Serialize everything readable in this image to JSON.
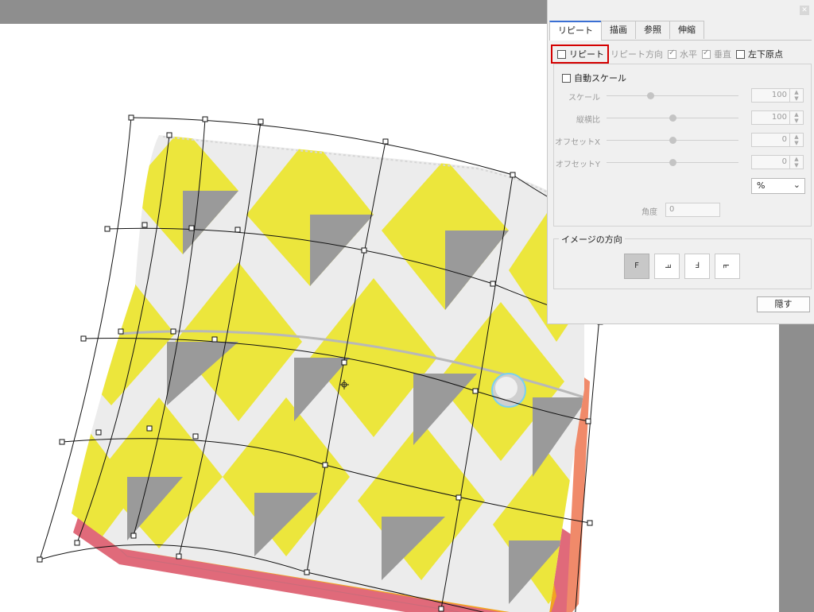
{
  "panel": {
    "tabs": [
      "リピート",
      "描画",
      "参照",
      "伸縮"
    ],
    "repeat_label": "リピート",
    "repeat_direction_label": "リピート方向",
    "horizontal_label": "水平",
    "vertical_label": "垂直",
    "bottom_left_origin_label": "左下原点",
    "auto_scale_label": "自動スケール",
    "params": [
      {
        "label": "スケール",
        "value": "100",
        "level": 0.33
      },
      {
        "label": "縦横比",
        "value": "100",
        "level": 0.5
      },
      {
        "label": "オフセットX",
        "value": "0",
        "level": 0.5
      },
      {
        "label": "オフセットY",
        "value": "0",
        "level": 0.5
      }
    ],
    "unit_value": "%",
    "angle_label": "角度",
    "angle_value": "0",
    "image_direction_label": "イメージの方向",
    "direction_buttons": [
      "F",
      "ꟻ",
      "Ⅎ",
      "ꟻ"
    ],
    "hide_button": "隠す"
  },
  "colors": {
    "pattern_yellow": "#ece63c",
    "pattern_grey": "#9a9a9a",
    "leather_white": "#ececec",
    "interior_orange": "#f2a421",
    "edge_pink": "#e06a7a",
    "highlight_red": "#d40000",
    "active_tab_blue": "#3a6fd3"
  },
  "icons": {
    "close": "close-icon",
    "pivot": "crosshair-icon",
    "dropdown": "chevron-down-icon"
  }
}
